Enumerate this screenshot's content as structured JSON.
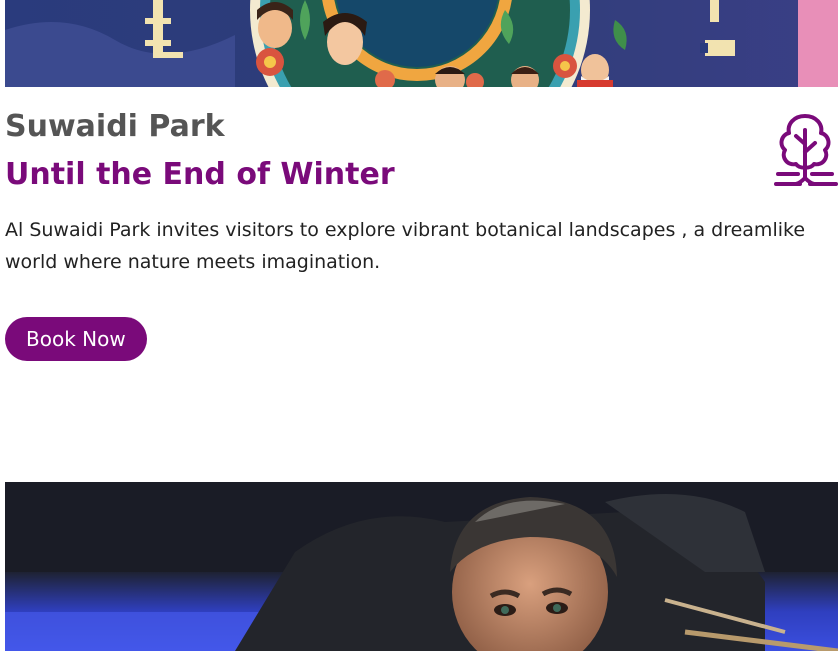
{
  "event": {
    "venue": "Suwaidi Park",
    "date_range": "Until the End of Winter",
    "description": "Al Suwaidi Park invites visitors to explore vibrant botanical landscapes , a dreamlike world where nature meets imagination.",
    "book_label": "Book Now",
    "icon": "tree-icon",
    "accent_color": "#7a0a7a"
  },
  "images": {
    "banner": "illustrated-festival-banner",
    "next_event": "snooker-player-photo"
  }
}
